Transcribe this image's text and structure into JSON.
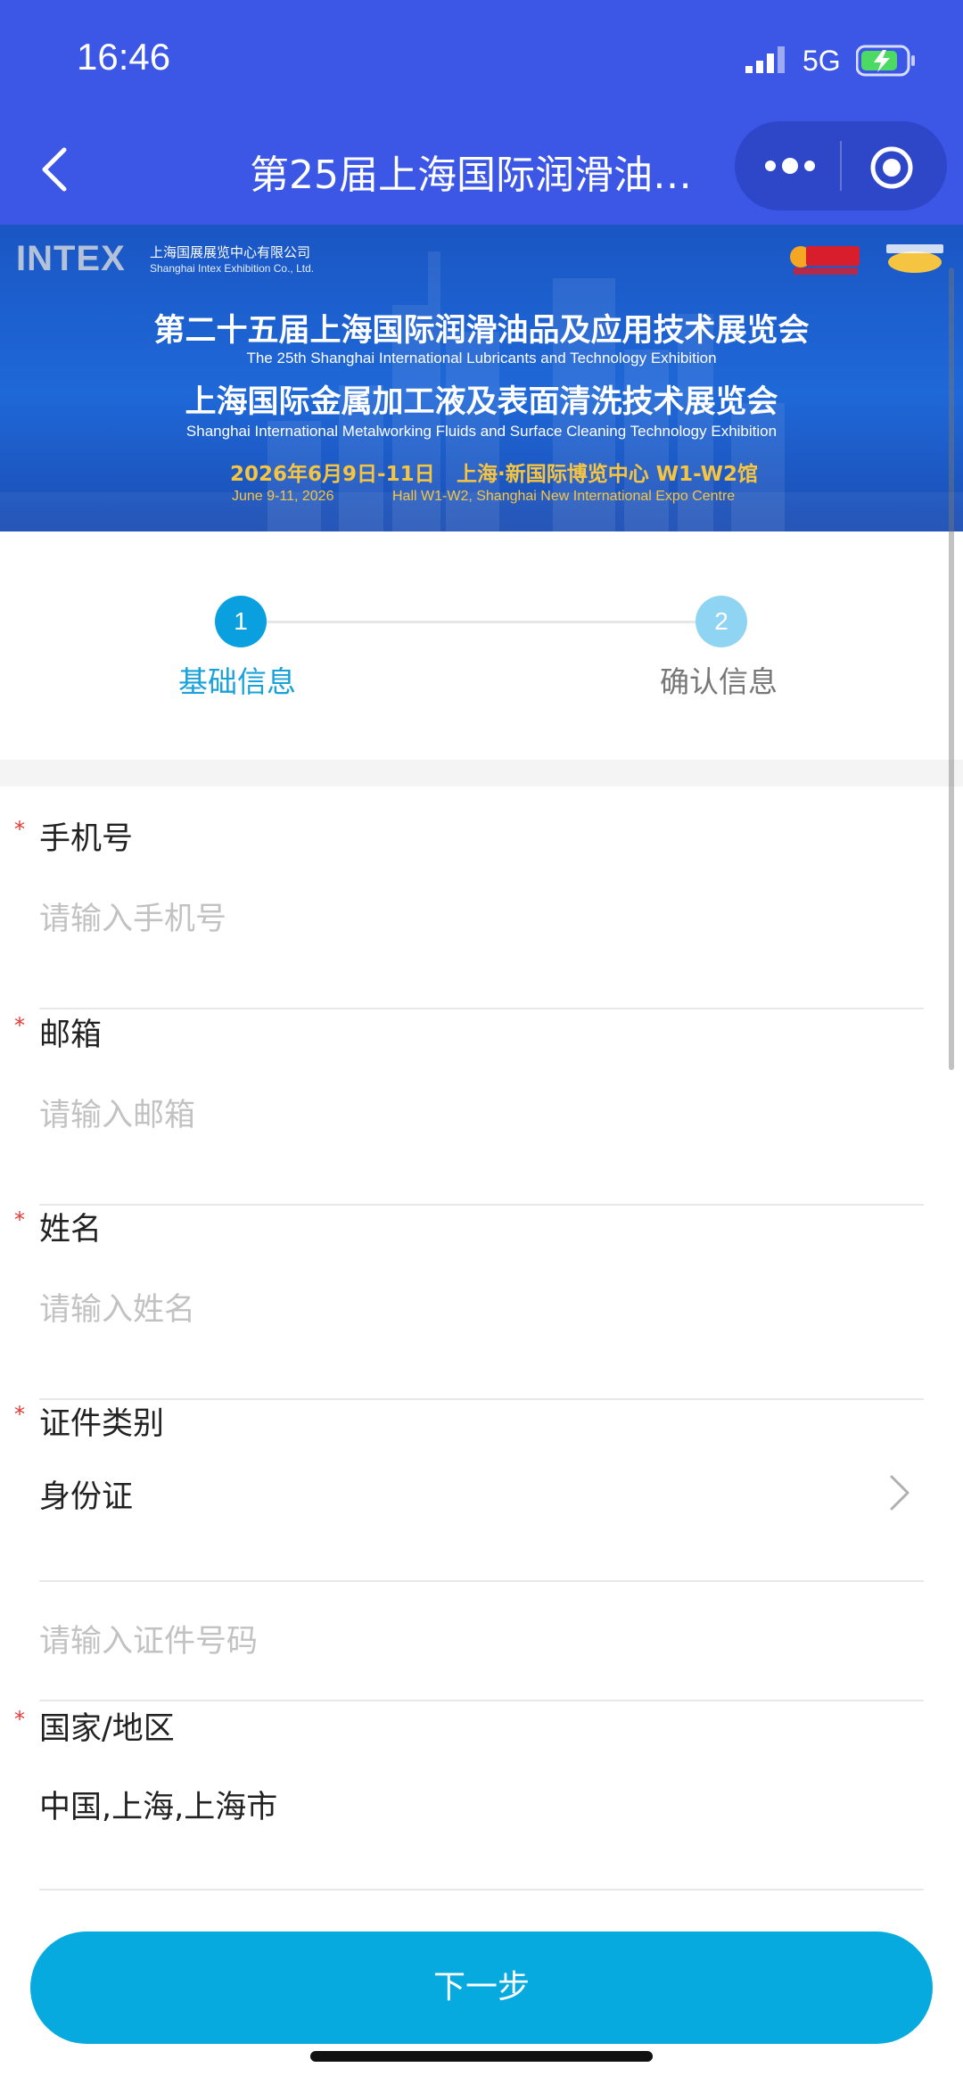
{
  "status_bar": {
    "time": "16:46",
    "network": "5G"
  },
  "nav": {
    "title": "第25届上海国际润滑油…"
  },
  "banner": {
    "brand": "INTEX",
    "brand_cn": "上海国展展览中心有限公司",
    "brand_en": "Shanghai Intex Exhibition Co., Ltd.",
    "title_cn_1": "第二十五届上海国际润滑油品及应用技术展览会",
    "title_en_1": "The 25th Shanghai International Lubricants and Technology Exhibition",
    "title_cn_2": "上海国际金属加工液及表面清洗技术展览会",
    "title_en_2": "Shanghai International Metalworking Fluids and Surface Cleaning Technology Exhibition",
    "date_cn": "2026年6月9日-11日",
    "venue_cn": "上海·新国际博览中心 W1-W2馆",
    "date_en": "June 9-11, 2026",
    "venue_en": "Hall W1-W2, Shanghai New International Expo Centre"
  },
  "steps": [
    {
      "num": "1",
      "label": "基础信息"
    },
    {
      "num": "2",
      "label": "确认信息"
    }
  ],
  "form": {
    "phone": {
      "required": "*",
      "label": "手机号",
      "placeholder": "请输入手机号"
    },
    "email": {
      "required": "*",
      "label": "邮箱",
      "placeholder": "请输入邮箱"
    },
    "name": {
      "required": "*",
      "label": "姓名",
      "placeholder": "请输入姓名"
    },
    "id_type": {
      "required": "*",
      "label": "证件类别",
      "value": "身份证"
    },
    "id_number": {
      "placeholder": "请输入证件号码"
    },
    "region": {
      "required": "*",
      "label": "国家/地区",
      "value": "中国,上海,上海市"
    }
  },
  "bottom": {
    "next_label": "下一步"
  },
  "colors": {
    "header": "#3c57e6",
    "accent": "#07aadf",
    "required": "#e53935"
  },
  "icons": [
    "back-arrow-icon",
    "more-dots-icon",
    "close-ring-icon",
    "chevron-right-icon",
    "signal-icon",
    "battery-icon"
  ]
}
